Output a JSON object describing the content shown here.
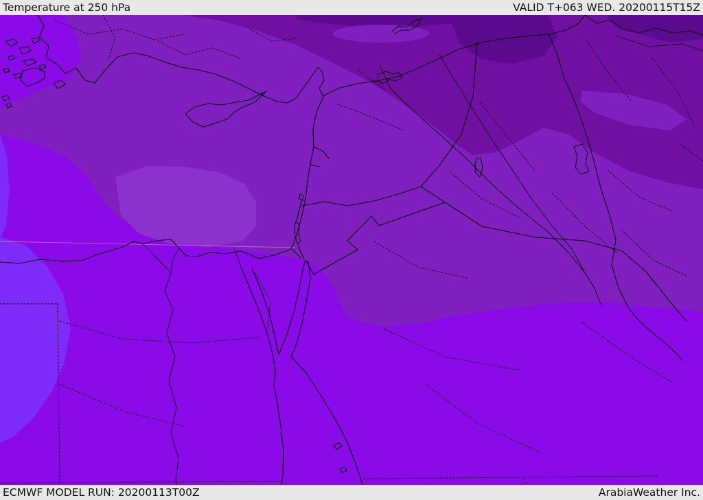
{
  "header": {
    "title": "Temperature at 250 hPa",
    "validity": "VALID T+063 WED. 20200115T15Z"
  },
  "footer": {
    "model_run": "ECMWF MODEL RUN: 20200113T00Z",
    "credit": "ArabiaWeather Inc."
  },
  "map": {
    "palette": {
      "shade_darkest": "#5c0b8e",
      "shade_dark": "#6f10a2",
      "shade_medium": "#8020c0",
      "shade_medium_light": "#8b31cc",
      "shade_bright": "#8a0ae8",
      "shade_brightest": "#7e2bfa",
      "line_color": "#000000",
      "graticule_color": "#f0a8c0",
      "bar_background": "#e8e8e8",
      "text_color": "#111111"
    }
  }
}
